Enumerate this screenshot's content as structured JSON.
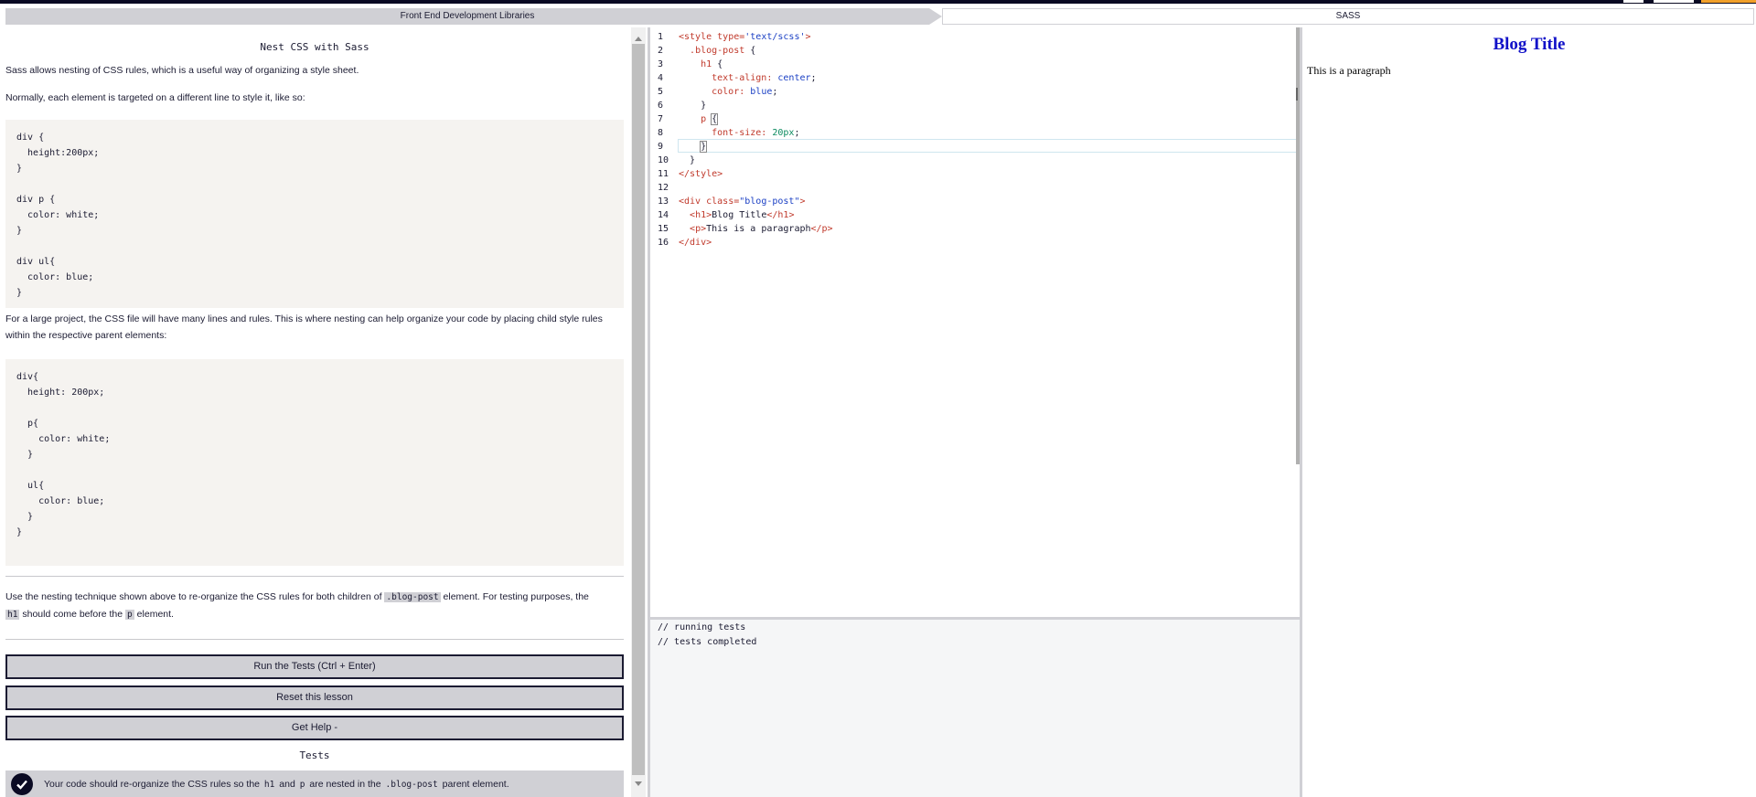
{
  "breadcrumb": {
    "parent": "Front End Development Libraries",
    "current": "SASS"
  },
  "instructions": {
    "title": "Nest CSS with Sass",
    "p1": "Sass allows nesting of CSS rules, which is a useful way of organizing a style sheet.",
    "p2": "Normally, each element is targeted on a different line to style it, like so:",
    "code1": "div {\n  height:200px;\n}\n\ndiv p {\n  color: white;\n}\n\ndiv ul{\n  color: blue;\n}",
    "p3": "For a large project, the CSS file will have many lines and rules. This is where nesting can help organize your code by placing child style rules within the respective parent elements:",
    "code2": "div{\n  height: 200px;\n\n  p{\n    color: white;\n  }\n\n  ul{\n    color: blue;\n  }\n}",
    "task_a": "Use the nesting technique shown above to re-organize the CSS rules for both children of ",
    "task_code1": ".blog-post",
    "task_b": " element. For testing purposes, the ",
    "task_code2": "h1",
    "task_c": " should come before the ",
    "task_code3": "p",
    "task_d": " element."
  },
  "buttons": {
    "run": "Run the Tests (Ctrl + Enter)",
    "reset": "Reset this lesson",
    "help": "Get Help -"
  },
  "tests": {
    "heading": "Tests",
    "item_a": "Your code should re-organize the CSS rules so the ",
    "item_code1": "h1",
    "item_b": " and ",
    "item_code2": "p",
    "item_c": " are nested in the ",
    "item_code3": ".blog-post",
    "item_d": " parent element."
  },
  "editor": {
    "line_numbers": [
      "1",
      "2",
      "3",
      "4",
      "5",
      "6",
      "7",
      "8",
      "9",
      "10",
      "11",
      "12",
      "13",
      "14",
      "15",
      "16"
    ]
  },
  "console": {
    "line1": "// running tests",
    "line2": "// tests completed"
  },
  "preview": {
    "title": "Blog Title",
    "paragraph": "This is a paragraph"
  },
  "colors": {
    "accent": "#f1a02a",
    "nav": "#0a0a23",
    "preview_title": "#1010c8"
  }
}
